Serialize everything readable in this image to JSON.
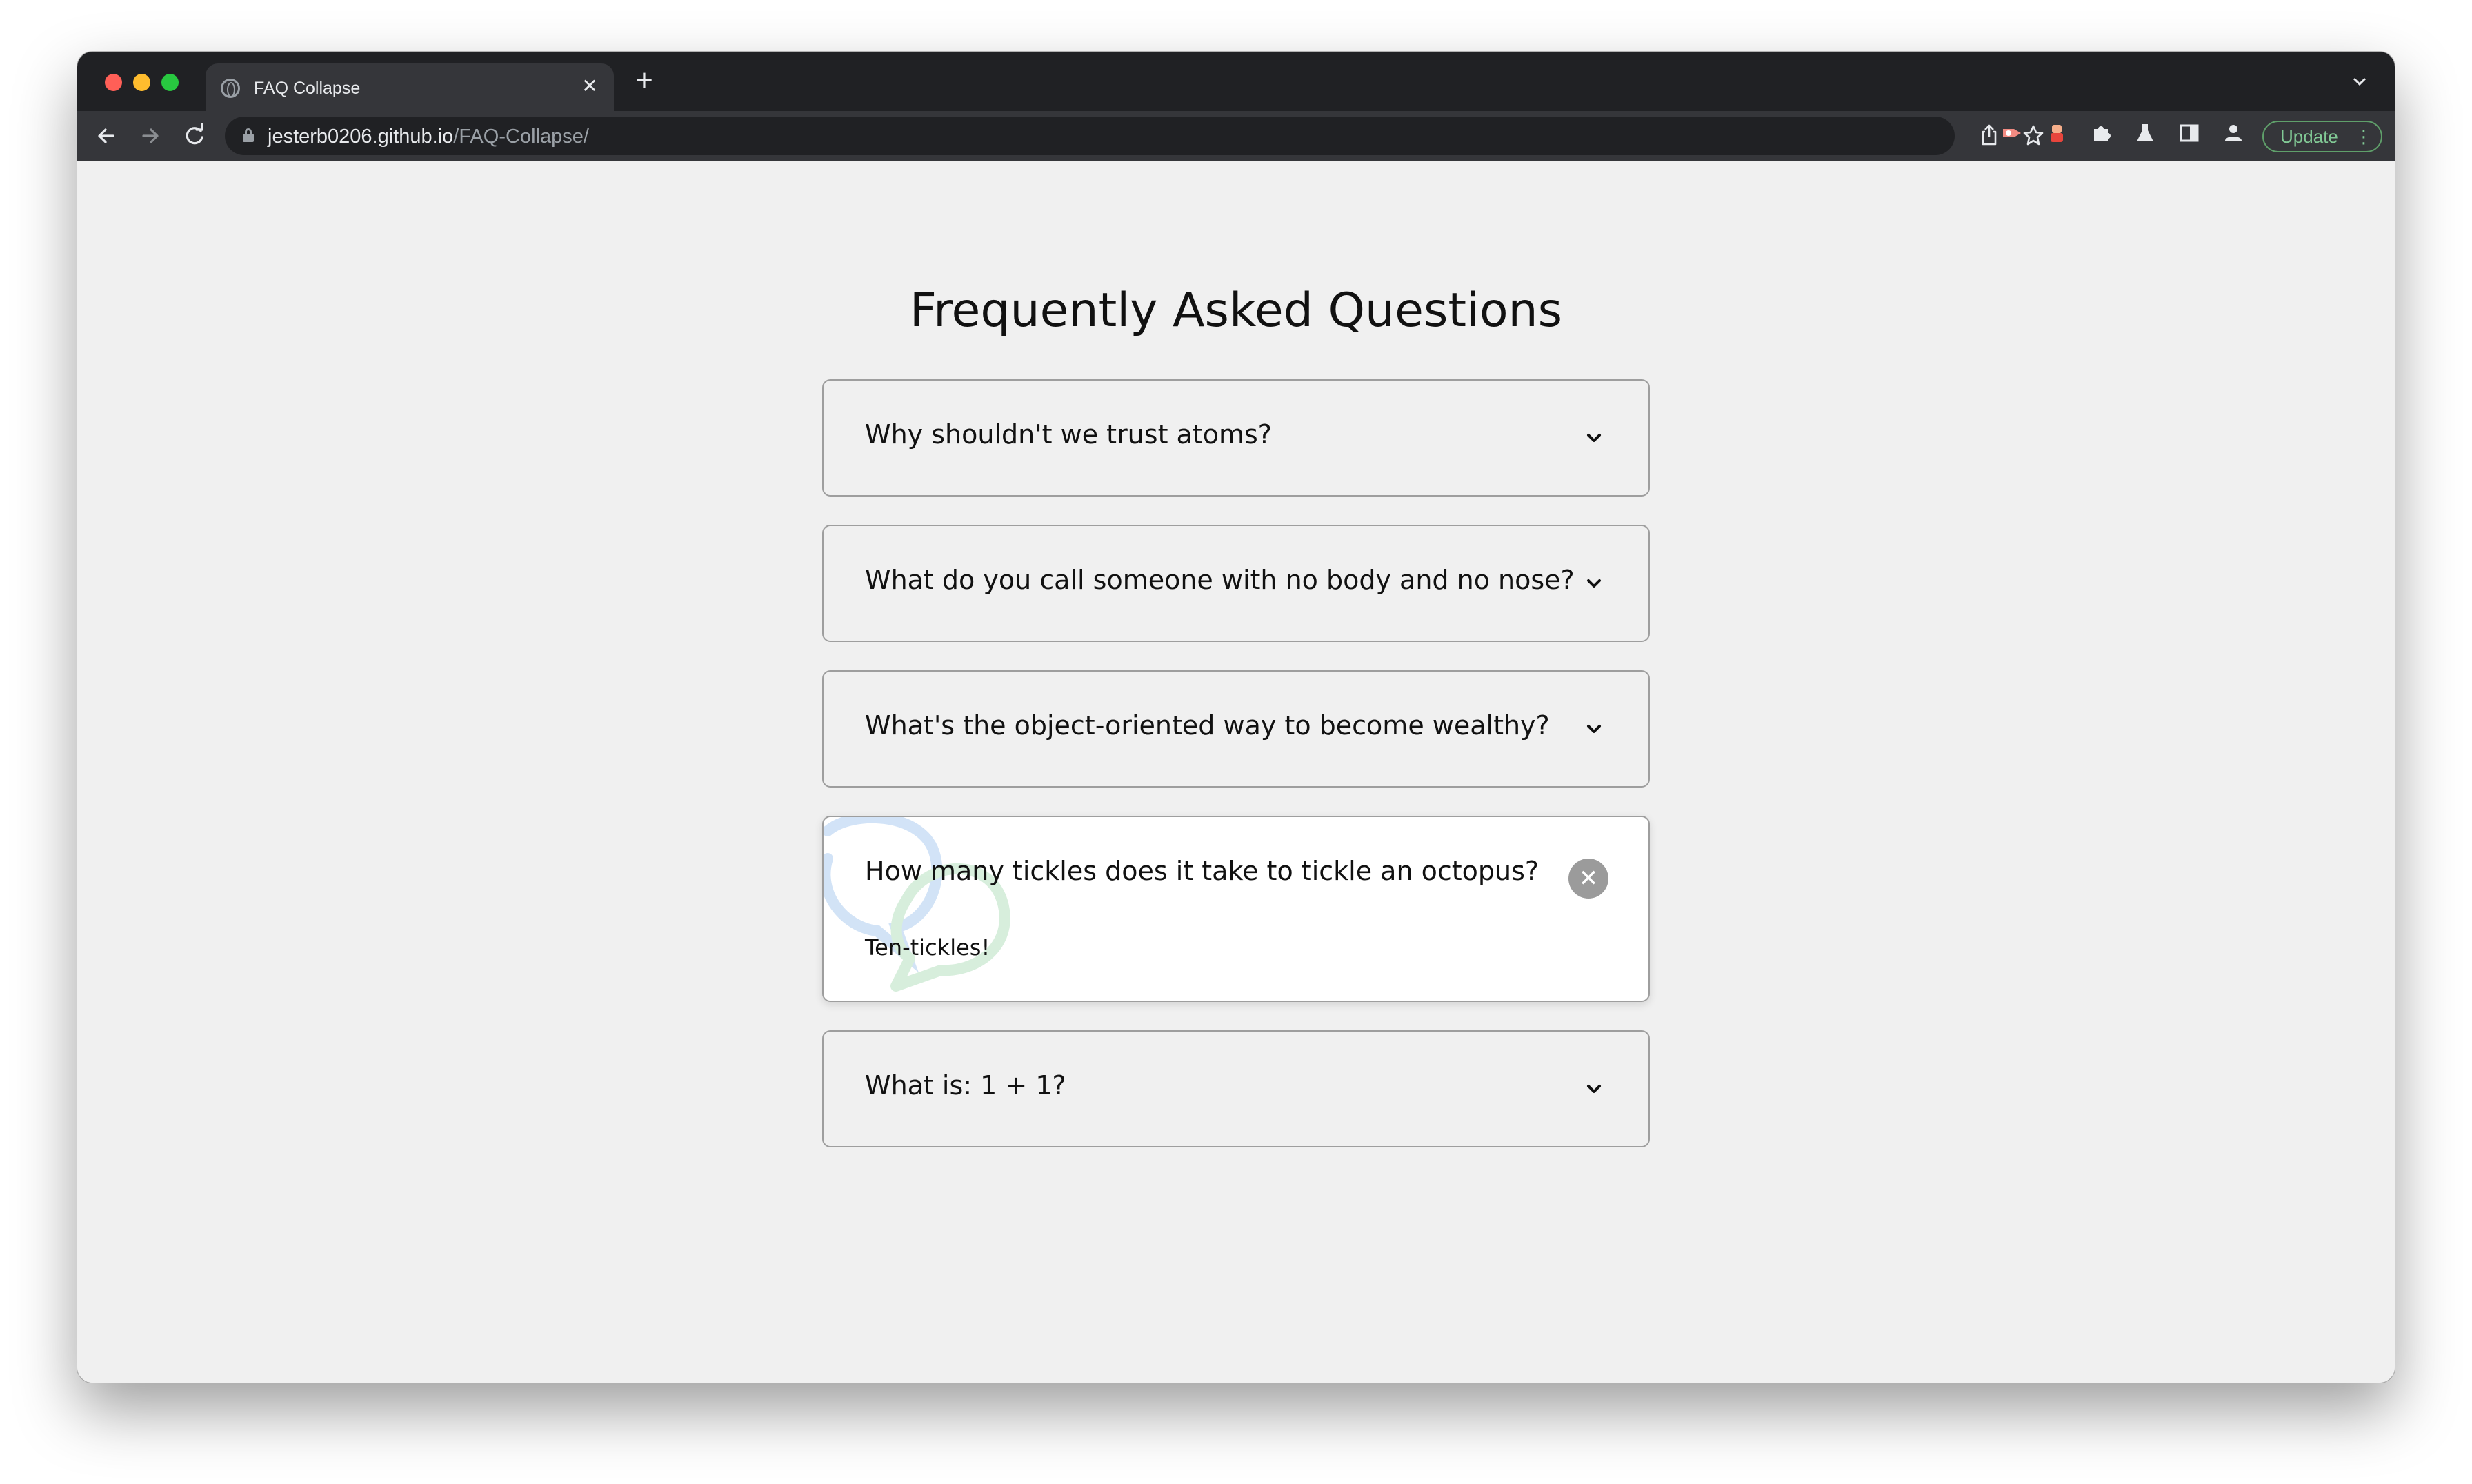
{
  "browser": {
    "tab_title": "FAQ Collapse",
    "tab_close_glyph": "✕",
    "new_tab_glyph": "+",
    "url_host": "jesterb0206.github.io",
    "url_path": "/FAQ-Collapse/",
    "update_label": "Update"
  },
  "page": {
    "title": "Frequently Asked Questions"
  },
  "faqs": [
    {
      "question": "Why shouldn't we trust atoms?",
      "open": false
    },
    {
      "question": "What do you call someone with no body and no nose?",
      "open": false
    },
    {
      "question": "What's the object-oriented way to become wealthy?",
      "open": false
    },
    {
      "question": "How many tickles does it take to tickle an octopus?",
      "answer": "Ten-tickles!",
      "open": true
    },
    {
      "question": "What is: 1 + 1?",
      "open": false
    }
  ],
  "colors": {
    "chrome_dark": "#202124",
    "toolbar": "#35363a",
    "page_bg": "#f0f0f0",
    "close_button": "#9b9b9b",
    "update_green": "#81c995"
  },
  "icons": [
    "back-arrow-icon",
    "forward-arrow-icon",
    "reload-icon",
    "lock-icon",
    "share-icon",
    "star-icon",
    "extension-icon",
    "puzzle-icon",
    "flask-icon",
    "sidebar-icon",
    "profile-icon",
    "chevron-down-icon",
    "close-icon",
    "chat-bubble-icon"
  ]
}
